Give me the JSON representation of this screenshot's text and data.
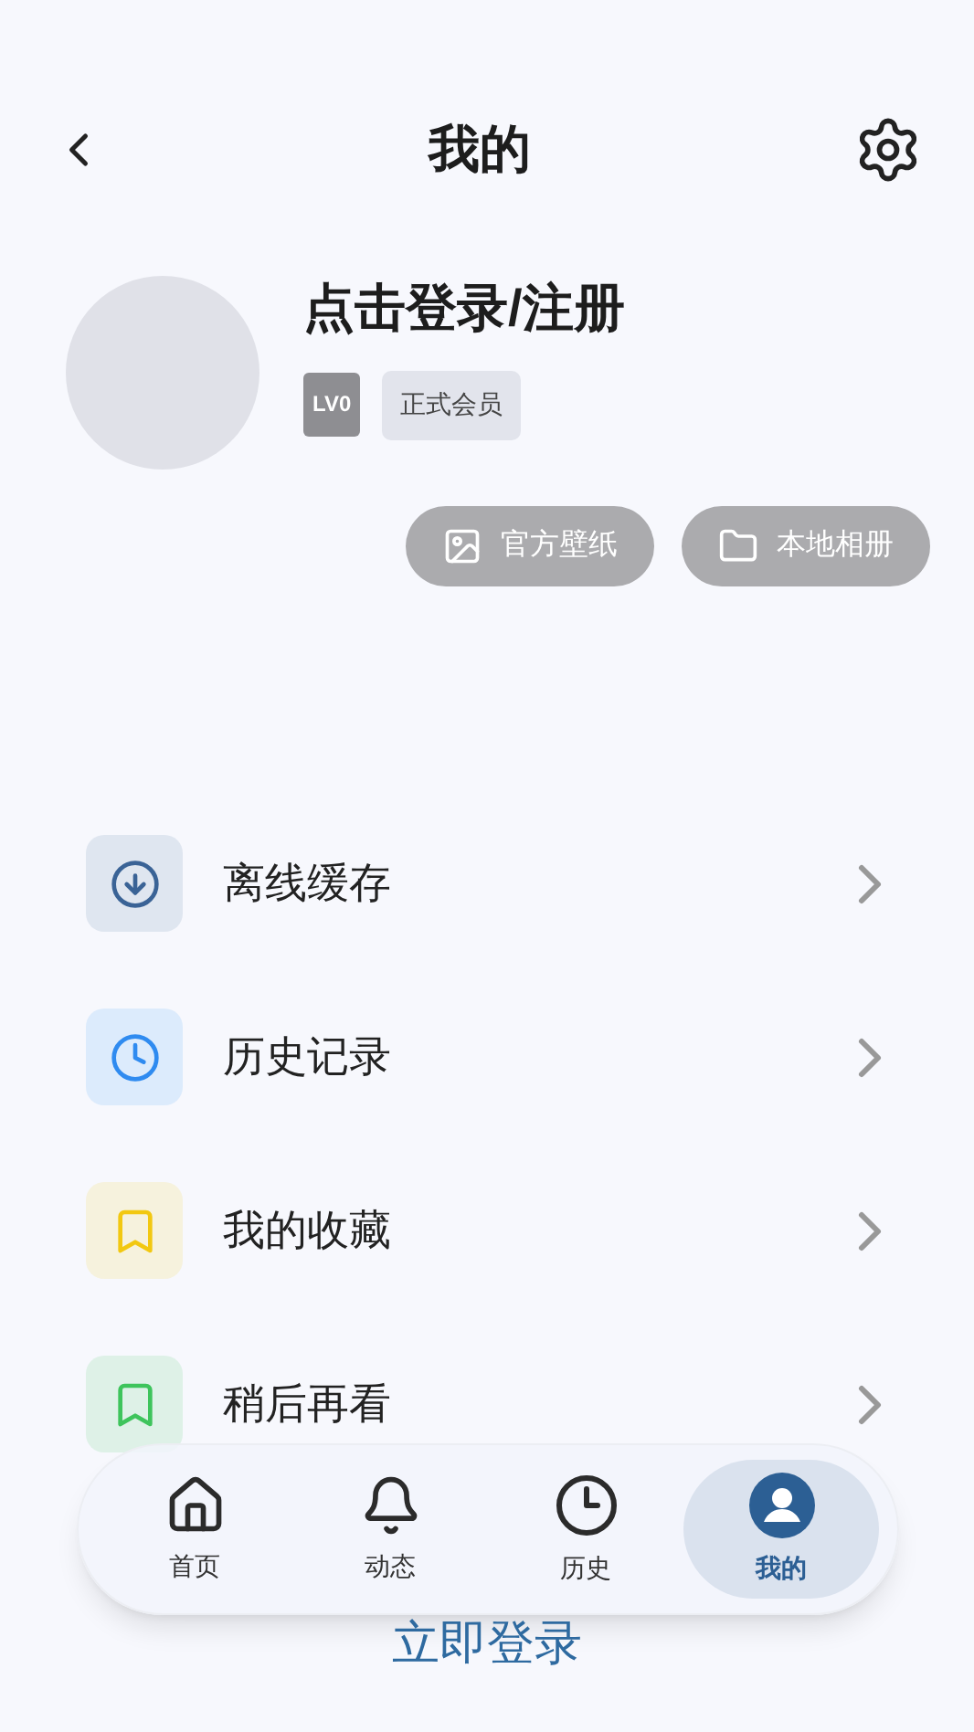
{
  "header": {
    "title": "我的"
  },
  "profile": {
    "name": "点击登录/注册",
    "level": "LV0",
    "membership": "正式会员"
  },
  "actions": [
    {
      "kind": "image",
      "label": "官方壁纸"
    },
    {
      "kind": "folder",
      "label": "本地相册"
    }
  ],
  "menu": [
    {
      "kind": "download",
      "label": "离线缓存",
      "color": "#3a6396"
    },
    {
      "kind": "clock",
      "label": "历史记录",
      "color": "#2f8bf0"
    },
    {
      "kind": "bookmark",
      "label": "我的收藏",
      "color": "#f2c811"
    },
    {
      "kind": "bookmark",
      "label": "稍后再看",
      "color": "#3ec45c"
    }
  ],
  "login_link": "立即登录",
  "bottom_nav": [
    {
      "kind": "home",
      "label": "首页",
      "selected": false
    },
    {
      "kind": "bell",
      "label": "动态",
      "selected": false
    },
    {
      "kind": "clock",
      "label": "历史",
      "selected": false
    },
    {
      "kind": "user",
      "label": "我的",
      "selected": true
    }
  ]
}
